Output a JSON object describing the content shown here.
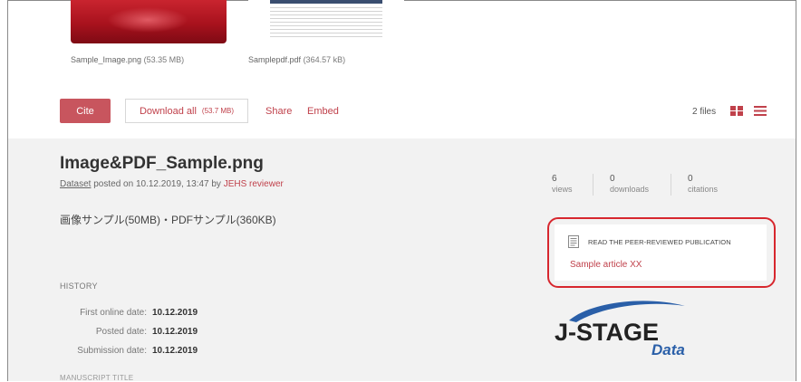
{
  "files": [
    {
      "name": "Sample_Image.png",
      "size": "(53.35 MB)",
      "thumb": "image-thumbnail"
    },
    {
      "name": "Samplepdf.pdf",
      "size": "(364.57 kB)",
      "thumb": "pdf-thumbnail"
    }
  ],
  "actions": {
    "cite_label": "Cite",
    "download_label": "Download all",
    "download_size": "(53.7 MB)",
    "share_label": "Share",
    "embed_label": "Embed",
    "files_count": "2 files"
  },
  "item": {
    "title": "Image&PDF_Sample.png",
    "type_link": "Dataset",
    "posted_text": " posted on 10.12.2019, 13:47 by ",
    "author": "JEHS reviewer",
    "description": "画像サンプル(50MB)・PDFサンプル(360KB)"
  },
  "stats": [
    {
      "value": "6",
      "label": "views"
    },
    {
      "value": "0",
      "label": "downloads"
    },
    {
      "value": "0",
      "label": "citations"
    }
  ],
  "history": {
    "heading": "HISTORY",
    "rows": [
      {
        "label": "First online date:",
        "value": "10.12.2019"
      },
      {
        "label": "Posted date:",
        "value": "10.12.2019"
      },
      {
        "label": "Submission date:",
        "value": "10.12.2019"
      }
    ],
    "next_heading_partial": "MANUSCRIPT TITLE"
  },
  "publication": {
    "heading": "READ THE PEER-REVIEWED PUBLICATION",
    "link": "Sample article XX"
  },
  "logo": {
    "text_top": "J-STAGE",
    "text_bottom": "Data"
  },
  "colors": {
    "accent": "#c0414b",
    "highlight_box": "#d7272e",
    "panel_bg": "#f2f2f2",
    "logo_blue": "#2a5fa8"
  }
}
